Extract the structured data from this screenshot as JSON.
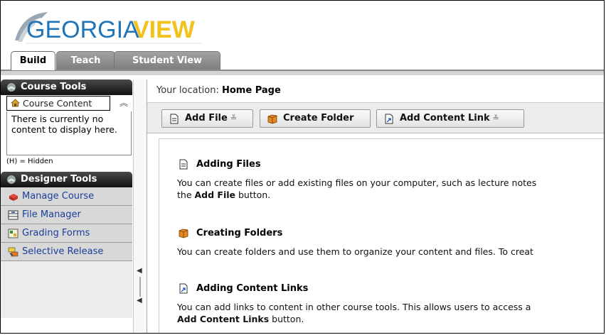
{
  "app": {
    "logo_text_georgia": "GEORGIA",
    "logo_text_view": "VIEW",
    "colors": {
      "logo_blue": "#1f74b8",
      "logo_yellow": "#f2c21b",
      "link_blue": "#1a3e9a",
      "panel_dark": "#1e1e1e"
    }
  },
  "tabs": [
    {
      "label": "Build",
      "active": true
    },
    {
      "label": "Teach",
      "active": false
    },
    {
      "label": "Student View",
      "active": false
    }
  ],
  "sidebar": {
    "course_tools_title": "Course Tools",
    "course_content_label": "Course Content",
    "empty_message": "There is currently no content to display here.",
    "hidden_legend": "(H) = Hidden",
    "designer_tools_title": "Designer Tools",
    "items": [
      {
        "label": "Manage Course",
        "icon": "manage-course-icon"
      },
      {
        "label": "File Manager",
        "icon": "file-manager-icon"
      },
      {
        "label": "Grading Forms",
        "icon": "grading-forms-icon"
      },
      {
        "label": "Selective Release",
        "icon": "selective-release-icon"
      }
    ]
  },
  "location": {
    "prefix": "Your location:",
    "page": "Home Page"
  },
  "toolbar": {
    "add_file": "Add File",
    "create_folder": "Create Folder",
    "add_content_link": "Add Content Link",
    "dropdown_glyph": "≚"
  },
  "sections": [
    {
      "title": "Adding Files",
      "line1": "You can create files or add existing files on your computer, such as lecture notes",
      "line2_prefix": "the ",
      "line2_bold": "Add File",
      "line2_suffix": " button."
    },
    {
      "title": "Creating Folders",
      "line1": "You can create folders and use them to organize your content and files. To creat"
    },
    {
      "title": "Adding Content Links",
      "line1": "You can add links to content in other course tools. This allows users to access a",
      "line2_bold": "Add Content Links",
      "line2_suffix": " button."
    }
  ]
}
